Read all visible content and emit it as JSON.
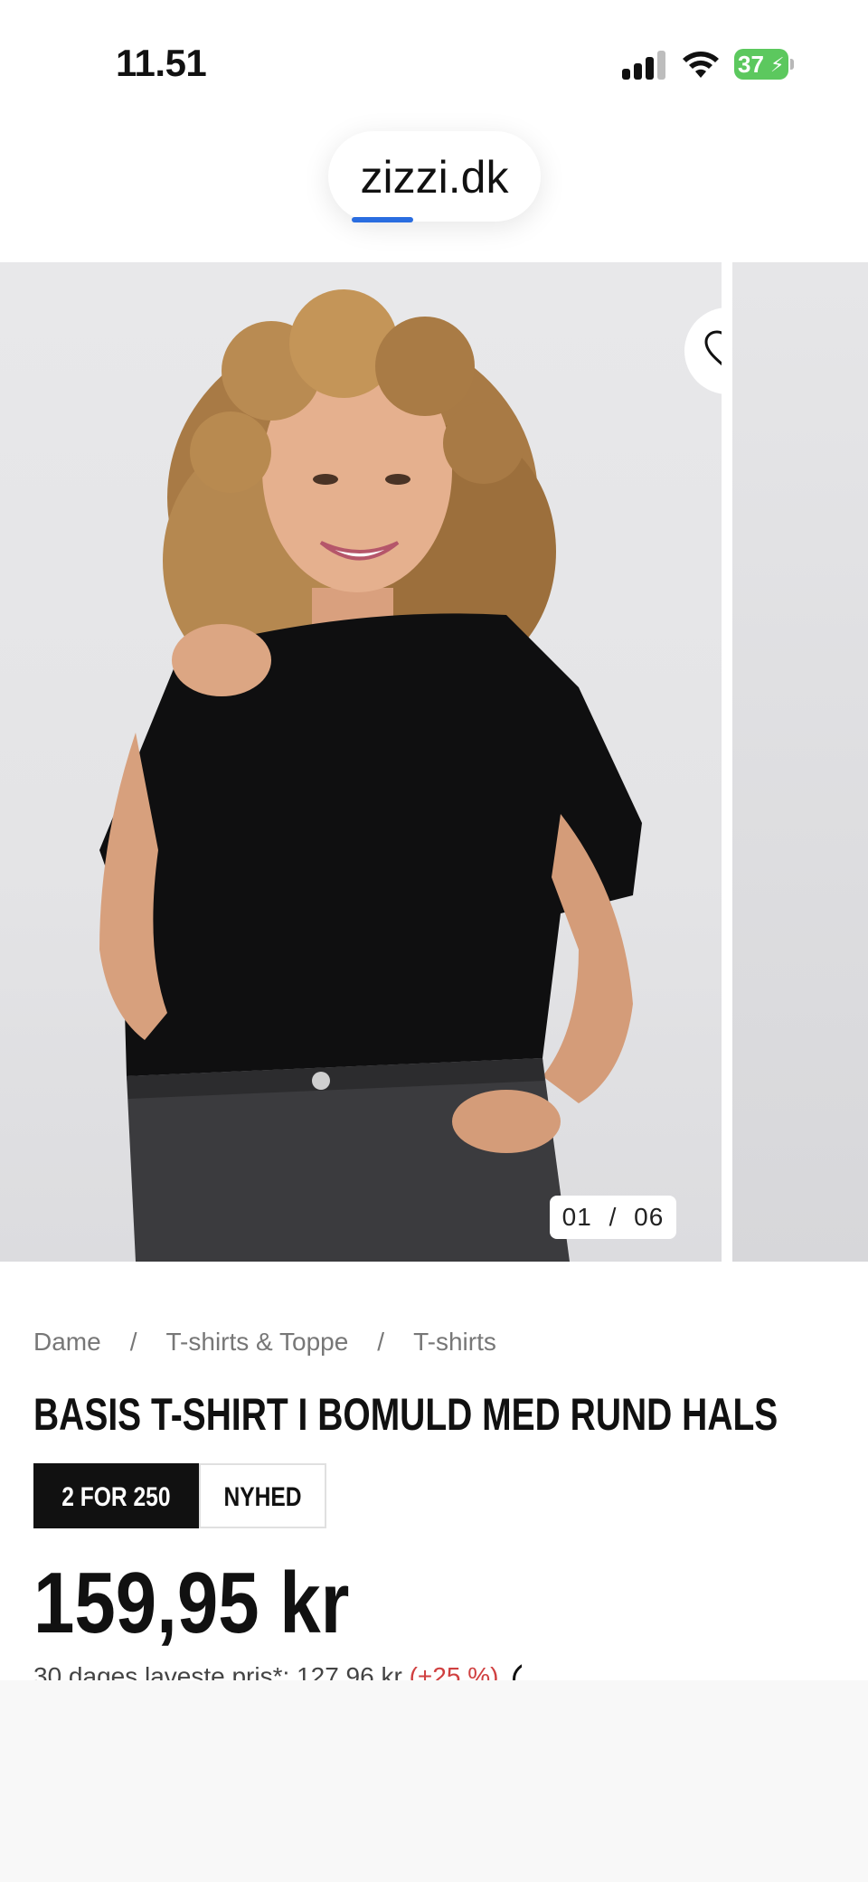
{
  "status_bar": {
    "time": "11.51",
    "battery": "37"
  },
  "browser": {
    "url": "zizzi.dk"
  },
  "gallery": {
    "counter_current": "01",
    "counter_separator": "/",
    "counter_total": "06",
    "wishlist_icon": "heart-icon"
  },
  "product": {
    "breadcrumb": [
      {
        "label": "Dame"
      },
      {
        "label": "T-shirts & Toppe"
      },
      {
        "label": "T-shirts"
      }
    ],
    "breadcrumb_separator": "/",
    "title": "BASIS T-SHIRT I BOMULD MED RUND HALS",
    "badges": [
      {
        "label": "2 FOR 250"
      },
      {
        "label": "NYHED"
      }
    ],
    "price": "159,95 kr",
    "lower_price_text": "30 dages laveste pris*: 127,96 kr",
    "lower_price_percent": "(+25 %)"
  },
  "colors": {
    "accent_progress": "#2a6de0",
    "battery_green": "#5cc85e",
    "discount_red": "#d04040"
  }
}
